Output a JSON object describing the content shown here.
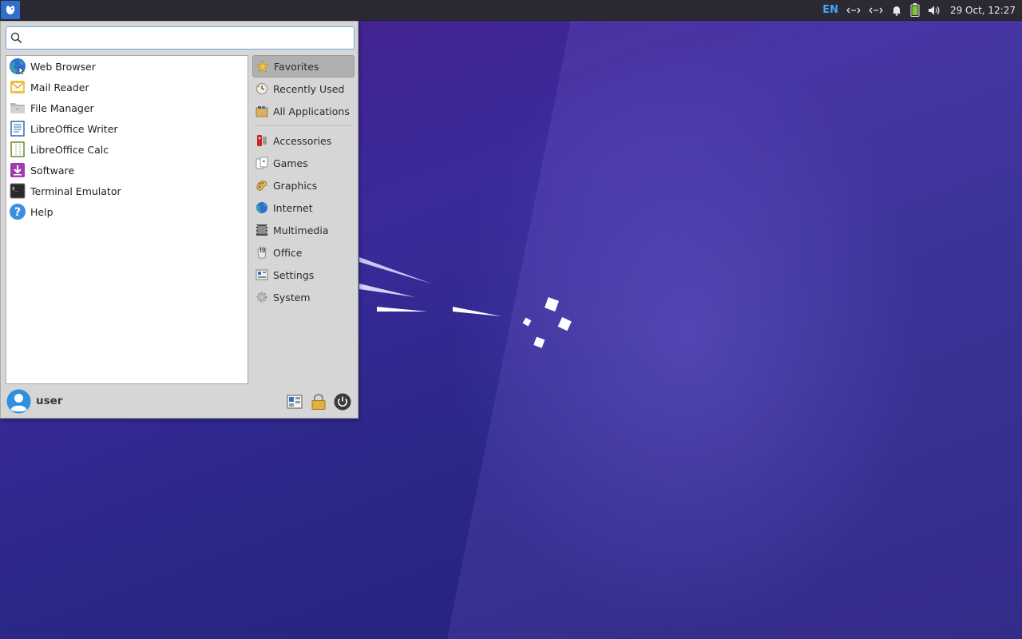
{
  "panel": {
    "keyboard_layout": "EN",
    "clock": "29 Oct, 12:27",
    "icons": [
      "xfce-menu-icon",
      "network-icon",
      "network-icon",
      "bell-icon",
      "battery-icon",
      "speaker-icon"
    ]
  },
  "search": {
    "placeholder": "",
    "value": ""
  },
  "favorites": [
    {
      "label": "Web Browser",
      "icon": "globe-icon"
    },
    {
      "label": "Mail Reader",
      "icon": "mail-icon"
    },
    {
      "label": "File Manager",
      "icon": "folder-icon"
    },
    {
      "label": "LibreOffice Writer",
      "icon": "writer-icon"
    },
    {
      "label": "LibreOffice Calc",
      "icon": "calc-icon"
    },
    {
      "label": "Software",
      "icon": "software-icon"
    },
    {
      "label": "Terminal Emulator",
      "icon": "terminal-icon"
    },
    {
      "label": "Help",
      "icon": "help-icon"
    }
  ],
  "categories_top": [
    {
      "label": "Favorites",
      "icon": "star-icon",
      "active": true
    },
    {
      "label": "Recently Used",
      "icon": "clock-icon"
    },
    {
      "label": "All Applications",
      "icon": "applications-icon"
    }
  ],
  "categories": [
    {
      "label": "Accessories",
      "icon": "accessories-icon"
    },
    {
      "label": "Games",
      "icon": "games-icon"
    },
    {
      "label": "Graphics",
      "icon": "graphics-icon"
    },
    {
      "label": "Internet",
      "icon": "internet-icon"
    },
    {
      "label": "Multimedia",
      "icon": "multimedia-icon"
    },
    {
      "label": "Office",
      "icon": "office-icon"
    },
    {
      "label": "Settings",
      "icon": "settings-icon"
    },
    {
      "label": "System",
      "icon": "system-icon"
    }
  ],
  "footer": {
    "username": "user",
    "buttons": [
      "settings-manager-icon",
      "lock-icon",
      "power-icon"
    ]
  },
  "colors": {
    "panel_bg": "#2b2a33",
    "menu_bg": "#d6d6d6",
    "accent": "#2f6fd0",
    "keyboard_layout": "#4aa3f0"
  }
}
